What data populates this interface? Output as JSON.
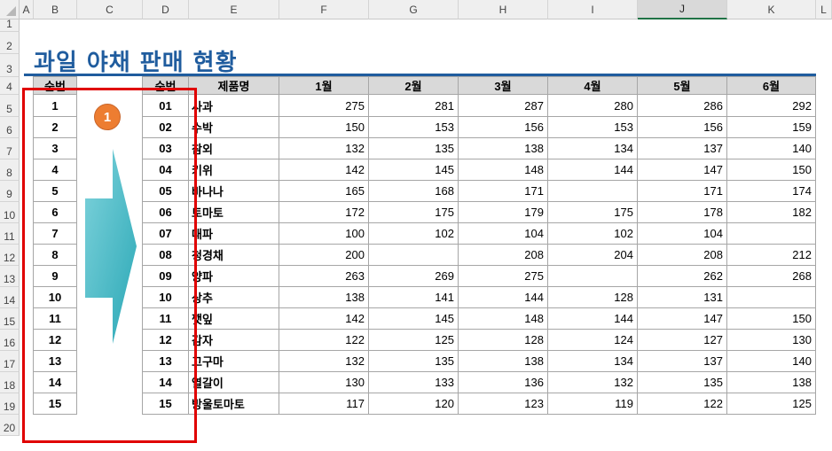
{
  "sheet": {
    "columns": [
      "A",
      "B",
      "C",
      "D",
      "E",
      "F",
      "G",
      "H",
      "I",
      "J",
      "K",
      "L"
    ],
    "selected_column": "J",
    "rows": [
      "1",
      "2",
      "3",
      "4",
      "5",
      "6",
      "7",
      "8",
      "9",
      "10",
      "11",
      "12",
      "13",
      "14",
      "15",
      "16",
      "17",
      "18",
      "19",
      "20"
    ]
  },
  "title": "과일 야채 판매 현황",
  "callout": {
    "badge": "1",
    "badge_color": "#ed7d31",
    "arrow_color": "#3fb9c6",
    "highlight_color": "#e00000"
  },
  "left_table": {
    "header": "순번",
    "values": [
      "1",
      "2",
      "3",
      "4",
      "5",
      "6",
      "7",
      "8",
      "9",
      "10",
      "11",
      "12",
      "13",
      "14",
      "15"
    ]
  },
  "main_table": {
    "headers": [
      "순번",
      "제품명",
      "1월",
      "2월",
      "3월",
      "4월",
      "5월",
      "6월"
    ],
    "rows": [
      {
        "no": "01",
        "name": "사과",
        "m": [
          "275",
          "281",
          "287",
          "280",
          "286",
          "292"
        ]
      },
      {
        "no": "02",
        "name": "수박",
        "m": [
          "150",
          "153",
          "156",
          "153",
          "156",
          "159"
        ]
      },
      {
        "no": "03",
        "name": "참외",
        "m": [
          "132",
          "135",
          "138",
          "134",
          "137",
          "140"
        ]
      },
      {
        "no": "04",
        "name": "키위",
        "m": [
          "142",
          "145",
          "148",
          "144",
          "147",
          "150"
        ]
      },
      {
        "no": "05",
        "name": "바나나",
        "m": [
          "165",
          "168",
          "171",
          "",
          "171",
          "174"
        ]
      },
      {
        "no": "06",
        "name": "토마토",
        "m": [
          "172",
          "175",
          "179",
          "175",
          "178",
          "182"
        ]
      },
      {
        "no": "07",
        "name": "대파",
        "m": [
          "100",
          "102",
          "104",
          "102",
          "104",
          ""
        ]
      },
      {
        "no": "08",
        "name": "청경채",
        "m": [
          "200",
          "",
          "208",
          "204",
          "208",
          "212"
        ]
      },
      {
        "no": "09",
        "name": "양파",
        "m": [
          "263",
          "269",
          "275",
          "",
          "262",
          "268"
        ]
      },
      {
        "no": "10",
        "name": "상추",
        "m": [
          "138",
          "141",
          "144",
          "128",
          "131",
          ""
        ]
      },
      {
        "no": "11",
        "name": "깻잎",
        "m": [
          "142",
          "145",
          "148",
          "144",
          "147",
          "150"
        ]
      },
      {
        "no": "12",
        "name": "감자",
        "m": [
          "122",
          "125",
          "128",
          "124",
          "127",
          "130"
        ]
      },
      {
        "no": "13",
        "name": "고구마",
        "m": [
          "132",
          "135",
          "138",
          "134",
          "137",
          "140"
        ]
      },
      {
        "no": "14",
        "name": "열갈이",
        "m": [
          "130",
          "133",
          "136",
          "132",
          "135",
          "138"
        ]
      },
      {
        "no": "15",
        "name": "방울토마토",
        "m": [
          "117",
          "120",
          "123",
          "119",
          "122",
          "125"
        ]
      }
    ]
  }
}
